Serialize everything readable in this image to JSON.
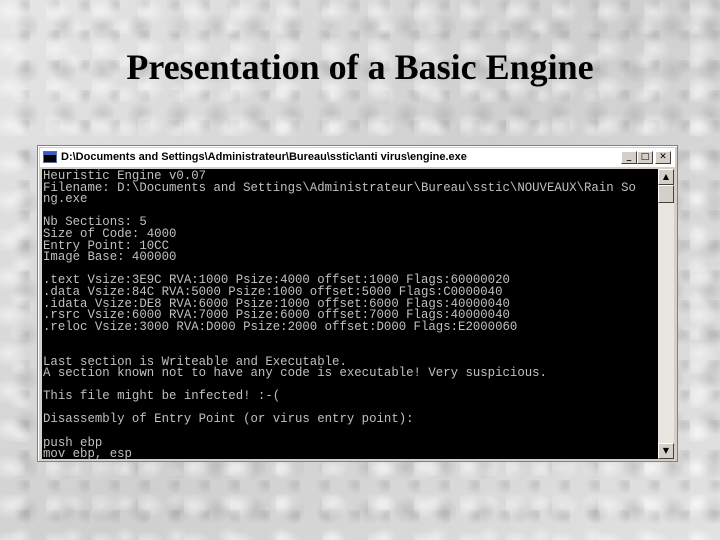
{
  "slide": {
    "title": "Presentation of a Basic Engine"
  },
  "window": {
    "title": "D:\\Documents and Settings\\Administrateur\\Bureau\\sstic\\anti virus\\engine.exe",
    "icon": "console-icon",
    "buttons": {
      "minimize": "_",
      "maximize": "□",
      "close": "✕"
    }
  },
  "console": {
    "lines": [
      "Heuristic Engine v0.07",
      "Filename: D:\\Documents and Settings\\Administrateur\\Bureau\\sstic\\NOUVEAUX\\Rain So",
      "ng.exe",
      "",
      "Nb Sections: 5",
      "Size of Code: 4000",
      "Entry Point: 10CC",
      "Image Base: 400000",
      "",
      ".text Vsize:3E9C RVA:1000 Psize:4000 offset:1000 Flags:60000020",
      ".data Vsize:84C RVA:5000 Psize:1000 offset:5000 Flags:C0000040",
      ".idata Vsize:DE8 RVA:6000 Psize:1000 offset:6000 Flags:40000040",
      ".rsrc Vsize:6000 RVA:7000 Psize:6000 offset:7000 Flags:40000040",
      ".reloc Vsize:3000 RVA:D000 Psize:2000 offset:D000 Flags:E2000060",
      "",
      "",
      "Last section is Writeable and Executable.",
      "A section known not to have any code is executable! Very suspicious.",
      "",
      "This file might be infected! :-(",
      "",
      "Disassembly of Entry Point (or virus entry point):",
      "",
      "push ebp",
      "mov ebp, esp"
    ]
  },
  "scrollbar": {
    "up_arrow": "▲",
    "down_arrow": "▼"
  }
}
